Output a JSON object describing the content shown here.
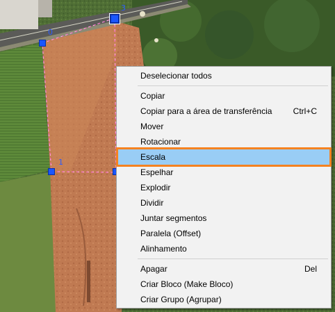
{
  "vertex_labels": [
    "0",
    "3",
    "1"
  ],
  "context_menu": {
    "items": [
      {
        "label": "Deselecionar todos",
        "shortcut": ""
      },
      {
        "label": "Copiar",
        "shortcut": ""
      },
      {
        "label": "Copiar para a área de transferência",
        "shortcut": "Ctrl+C"
      },
      {
        "label": "Mover",
        "shortcut": ""
      },
      {
        "label": "Rotacionar",
        "shortcut": ""
      },
      {
        "label": "Escala",
        "shortcut": "",
        "highlighted": true
      },
      {
        "label": "Espelhar",
        "shortcut": ""
      },
      {
        "label": "Explodir",
        "shortcut": ""
      },
      {
        "label": "Dividir",
        "shortcut": ""
      },
      {
        "label": "Juntar segmentos",
        "shortcut": ""
      },
      {
        "label": "Paralela (Offset)",
        "shortcut": ""
      },
      {
        "label": "Alinhamento",
        "shortcut": ""
      },
      {
        "label": "Apagar",
        "shortcut": "Del"
      },
      {
        "label": "Criar Bloco (Make Bloco)",
        "shortcut": ""
      },
      {
        "label": "Criar Grupo (Agrupar)",
        "shortcut": ""
      }
    ]
  },
  "colors": {
    "highlight_bg": "#99cdf5",
    "highlight_outline": "#f58220",
    "vertex_handle": "#1a56ff",
    "selection_dash": "#ff66cc"
  }
}
